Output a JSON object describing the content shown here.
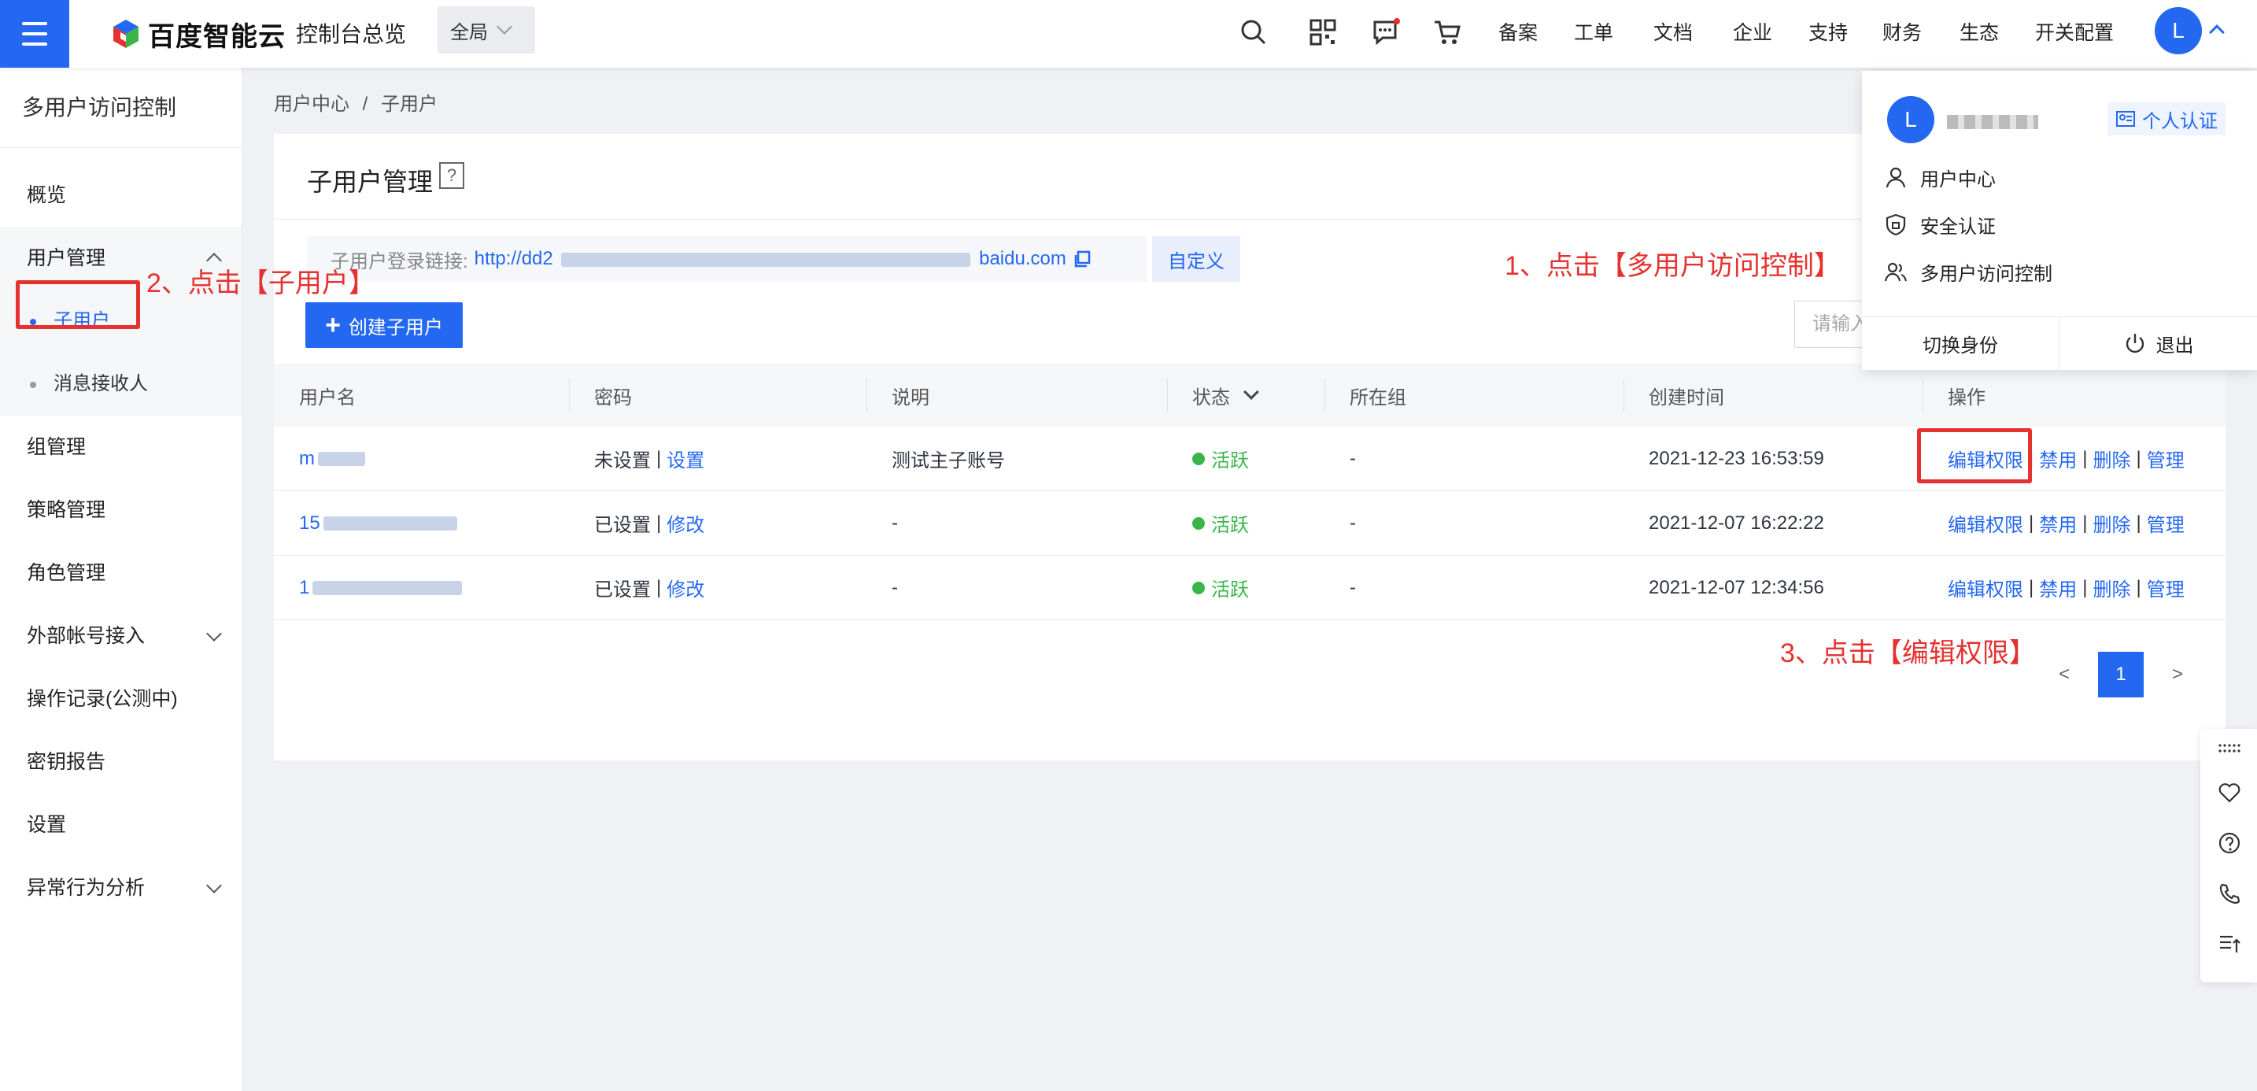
{
  "topbar": {
    "logo_text": "百度智能云",
    "console_title": "控制台总览",
    "scope": "全局",
    "nav": [
      "备案",
      "工单",
      "文档",
      "企业",
      "支持",
      "财务",
      "生态",
      "开关配置"
    ],
    "avatar_letter": "L",
    "icons": [
      "search-icon",
      "qrcode-icon",
      "message-icon",
      "cart-icon"
    ]
  },
  "sidebar": {
    "title": "多用户访问控制",
    "items": [
      {
        "label": "概览"
      },
      {
        "label": "用户管理",
        "expanded": true,
        "children": [
          {
            "label": "子用户",
            "active": true
          },
          {
            "label": "消息接收人"
          }
        ]
      },
      {
        "label": "组管理"
      },
      {
        "label": "策略管理"
      },
      {
        "label": "角色管理"
      },
      {
        "label": "外部帐号接入",
        "collapsible": true
      },
      {
        "label": "操作记录(公测中)"
      },
      {
        "label": "密钥报告"
      },
      {
        "label": "设置"
      },
      {
        "label": "异常行为分析",
        "collapsible": true
      }
    ]
  },
  "breadcrumb": {
    "root": "用户中心",
    "separator": "/",
    "current": "子用户"
  },
  "main": {
    "title": "子用户管理",
    "help": "?",
    "login_link_label": "子用户登录链接:",
    "login_link_prefix": "http://dd2",
    "login_link_suffix": "baidu.com",
    "customize": "自定义",
    "create_button": "创建子用户",
    "search_placeholder": "请输入"
  },
  "table": {
    "headers": [
      "用户名",
      "密码",
      "说明",
      "状态",
      "所在组",
      "创建时间",
      "操作"
    ],
    "rows": [
      {
        "username": "m",
        "pwd_state": "未设置",
        "pwd_action": "设置",
        "desc": "测试主子账号",
        "status": "活跃",
        "group": "-",
        "created": "2021-12-23 16:53:59"
      },
      {
        "username": "15",
        "pwd_state": "已设置",
        "pwd_action": "修改",
        "desc": "-",
        "status": "活跃",
        "group": "-",
        "created": "2021-12-07 16:22:22"
      },
      {
        "username": "1",
        "pwd_state": "已设置",
        "pwd_action": "修改",
        "desc": "-",
        "status": "活跃",
        "group": "-",
        "created": "2021-12-07 12:34:56"
      }
    ],
    "actions": [
      "编辑权限",
      "禁用",
      "删除",
      "管理"
    ],
    "action_sep": "|"
  },
  "pagination": {
    "prev": "<",
    "current": "1",
    "next": ">"
  },
  "dropdown": {
    "avatar_letter": "L",
    "verify": "个人认证",
    "items": [
      "用户中心",
      "安全认证",
      "多用户访问控制"
    ],
    "switch_identity": "切换身份",
    "logout": "退出"
  },
  "annotations": {
    "step1": "1、点击【多用户访问控制】",
    "step2": "2、点击【子用户】",
    "step3": "3、点击【编辑权限】",
    "color": "#e5312f"
  },
  "colors": {
    "brand": "#2468f2",
    "active_status": "#39b54a"
  }
}
